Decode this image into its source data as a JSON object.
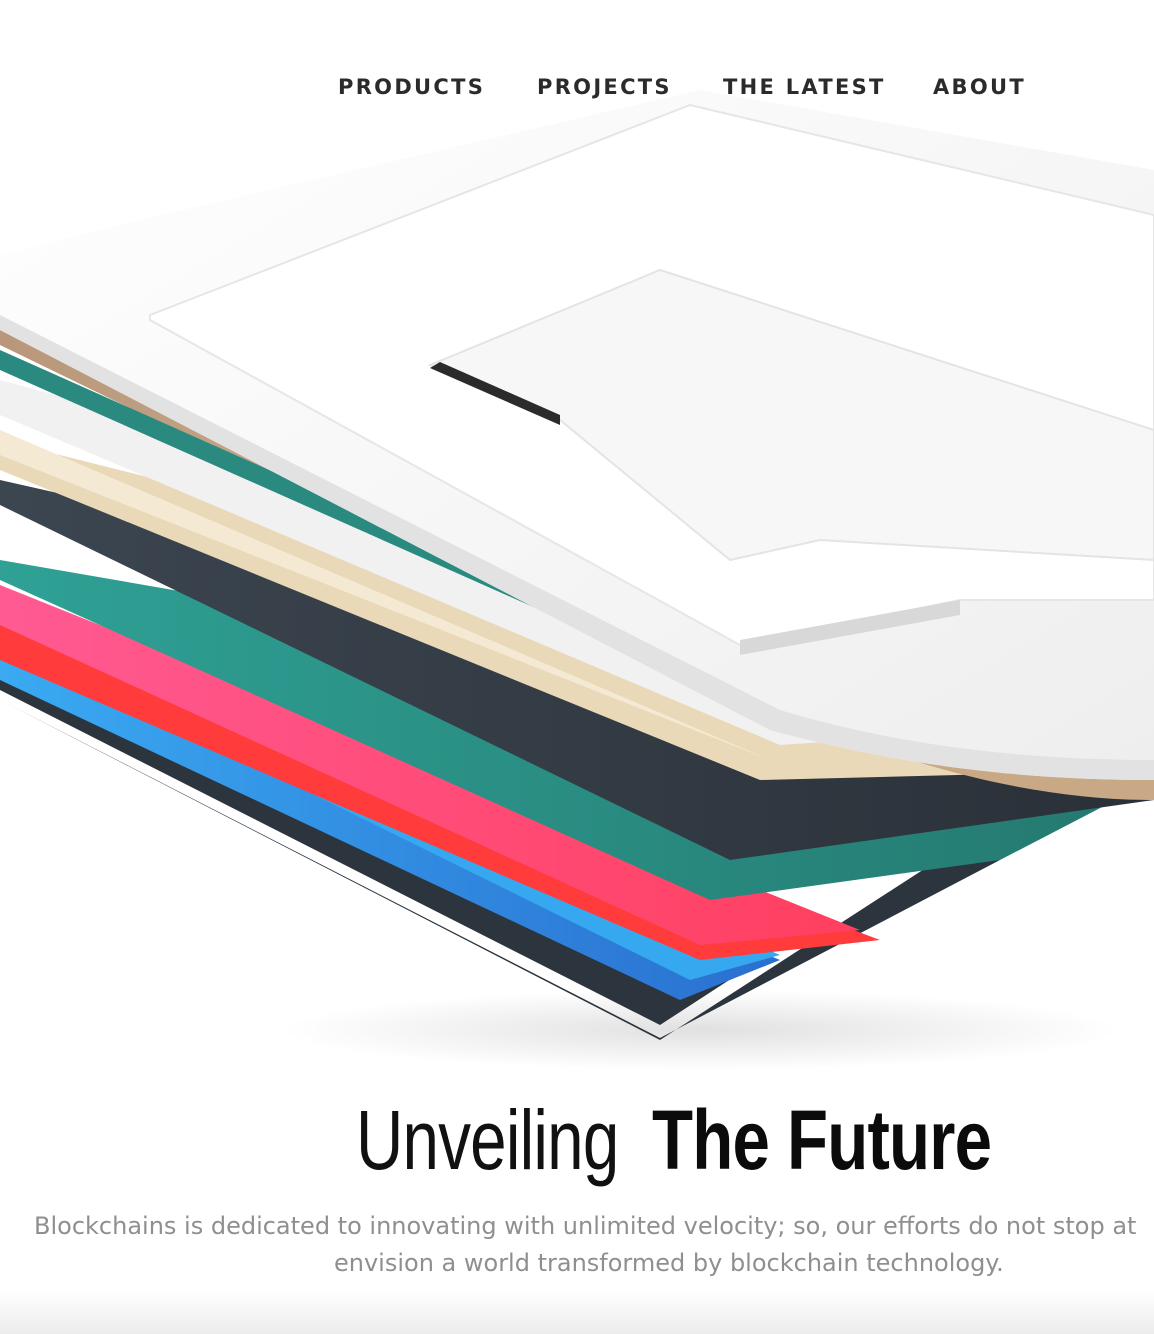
{
  "nav": {
    "items": [
      {
        "label": "PRODUCTS"
      },
      {
        "label": "PROJECTS"
      },
      {
        "label": "THE LATEST"
      },
      {
        "label": "ABOUT"
      }
    ]
  },
  "hero": {
    "image_icon": "layered-blockchain-illustration",
    "layer_colors": [
      "#f4f4f4",
      "#c9a886",
      "#2a8a80",
      "#e9d9b8",
      "#3d4650",
      "#2ea89a",
      "#ff4f8c",
      "#ff3b3b",
      "#35a8f0",
      "#2c343e"
    ]
  },
  "headline": {
    "light": "Unveiling",
    "bold": "The Future"
  },
  "description": {
    "line1": "Blockchains is dedicated to innovating with unlimited velocity; so, our efforts do not stop at",
    "line2": "envision a world transformed by blockchain technology."
  }
}
